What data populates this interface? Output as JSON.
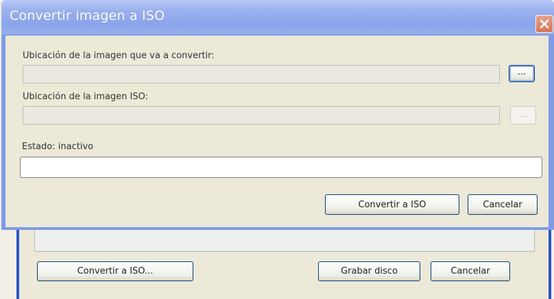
{
  "dialog": {
    "title": "Convertir imagen a ISO",
    "source_label": "Ubicación de la imagen que va a convertir:",
    "source_value": "",
    "browse_source_label": "...",
    "iso_label": "Ubicación de la imagen ISO:",
    "iso_value": "",
    "browse_iso_label": "...",
    "status_label": "Estado: inactivo",
    "progress_percent": 0,
    "convert_button": "Convertir a ISO",
    "cancel_button": "Cancelar"
  },
  "background_window": {
    "convert_button": "Convertir a ISO...",
    "burn_button": "Grabar disco",
    "cancel_button": "Cancelar"
  },
  "icons": {
    "close": "close-icon"
  },
  "colors": {
    "titlebar": "#8aa4eb",
    "frame": "#2b56c7",
    "close": "#d97555",
    "panel": "#ece9d8"
  }
}
